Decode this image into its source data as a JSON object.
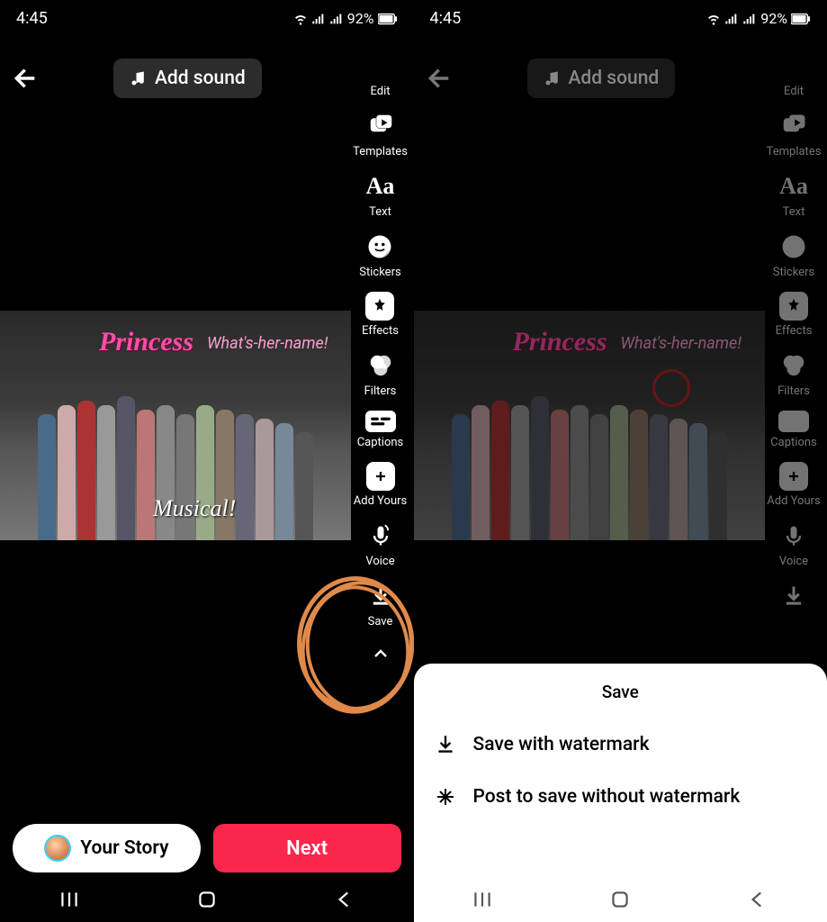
{
  "status": {
    "time": "4:45",
    "battery": "92%"
  },
  "top": {
    "add_sound": "Add sound"
  },
  "tools": {
    "edit": "Edit",
    "templates": "Templates",
    "text": "Text",
    "stickers": "Stickers",
    "effects": "Effects",
    "filters": "Filters",
    "captions": "Captions",
    "add_yours": "Add Yours",
    "voice": "Voice",
    "save": "Save"
  },
  "preview": {
    "text1": "Princess",
    "text2": "What's-her-name!",
    "text3": "Musical!"
  },
  "bottom": {
    "story": "Your Story",
    "next": "Next"
  },
  "sheet": {
    "title": "Save",
    "row1": "Save with watermark",
    "row2": "Post to save without watermark"
  }
}
